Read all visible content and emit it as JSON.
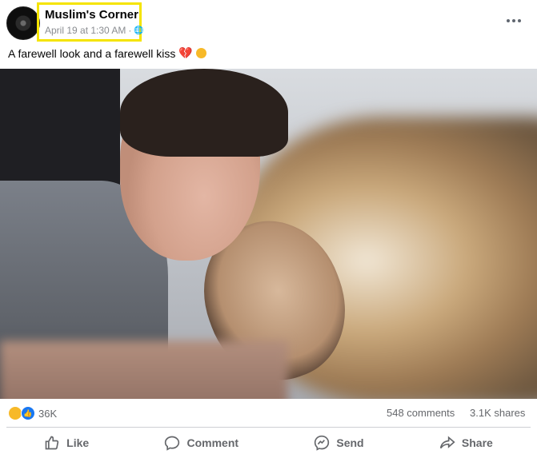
{
  "post": {
    "page_name": "Muslim's Corner",
    "timestamp": "April 19 at 1:30 AM",
    "separator": "·",
    "audience_icon": "globe-icon",
    "caption": "A farewell look and a farewell kiss",
    "caption_emojis": [
      "broken-heart-icon",
      "sad-face-icon"
    ]
  },
  "counts": {
    "reactions": "36K",
    "comments": "548 comments",
    "shares": "3.1K shares"
  },
  "actions": {
    "like": "Like",
    "comment": "Comment",
    "send": "Send",
    "share": "Share"
  },
  "colors": {
    "highlight": "#f5e400",
    "text_secondary": "#65676b",
    "like_blue": "#1877f2"
  }
}
